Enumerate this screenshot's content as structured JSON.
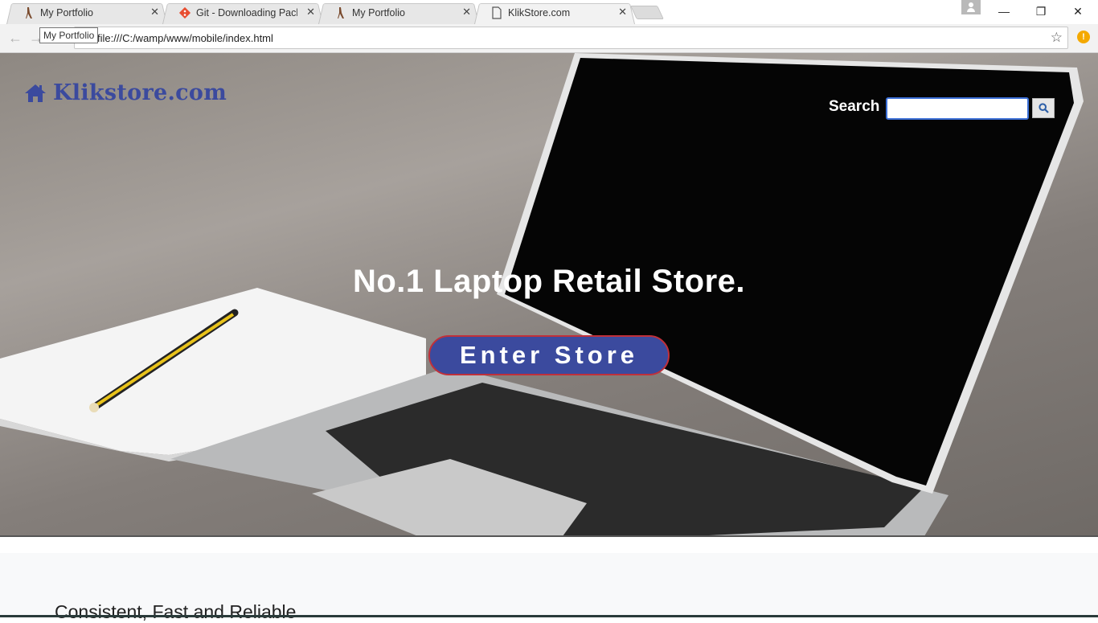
{
  "browser": {
    "tabs": [
      {
        "title": "My Portfolio",
        "icon": "portfolio-favicon"
      },
      {
        "title": "Git - Downloading Packa",
        "icon": "git-favicon"
      },
      {
        "title": "My Portfolio",
        "icon": "portfolio-favicon"
      },
      {
        "title": "KlikStore.com",
        "icon": "page-favicon",
        "active": true
      }
    ],
    "url": "file:///C:/wamp/www/mobile/index.html",
    "tooltip": "My Portfolio",
    "window_controls": {
      "minimize": "—",
      "restore": "❐",
      "close": "✕"
    }
  },
  "page": {
    "brand": "Klikstore.com",
    "search_label": "Search",
    "search_placeholder": "",
    "headline": "No.1 Laptop Retail Store.",
    "cta": "Enter Store",
    "section_heading": "Consistent, Fast and Reliable",
    "colors": {
      "brand": "#3b4a9e",
      "cta_border": "#c0303a"
    }
  }
}
